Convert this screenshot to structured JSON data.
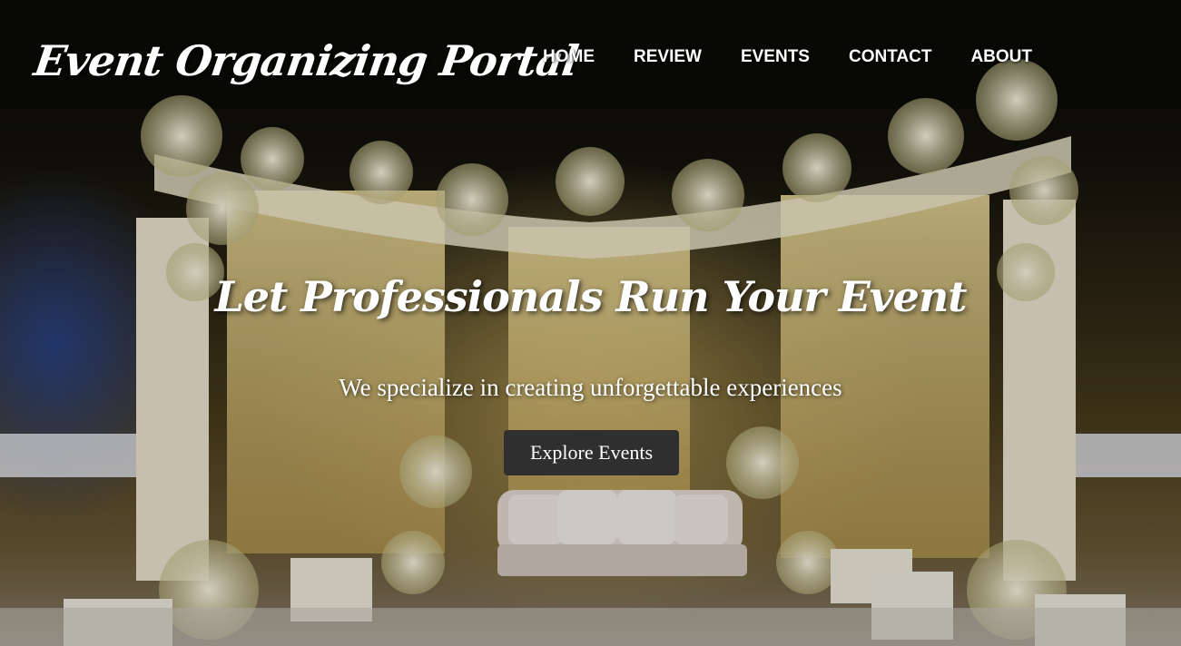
{
  "brand": {
    "logo_text": "Event Organizing Portal"
  },
  "nav": {
    "items": [
      {
        "label": "HOME"
      },
      {
        "label": "REVIEW"
      },
      {
        "label": "EVENTS"
      },
      {
        "label": "CONTACT"
      },
      {
        "label": "ABOUT"
      }
    ]
  },
  "hero": {
    "headline": "Let Professionals Run Your Event",
    "subheadline": "We specialize in creating unforgettable experiences",
    "cta_label": "Explore Events",
    "cta_color": "#2f2f2f"
  }
}
